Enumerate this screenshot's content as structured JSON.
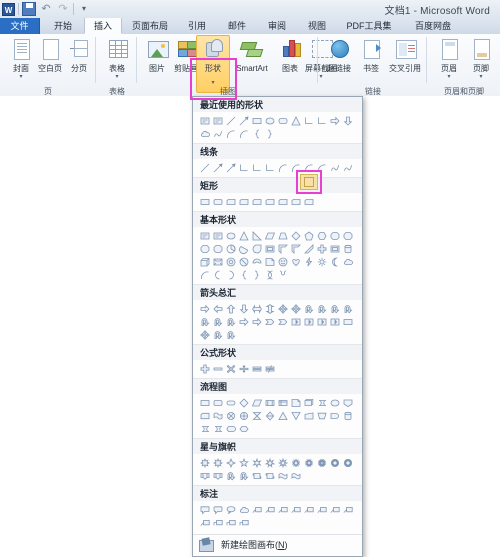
{
  "window": {
    "title": "文档1 - Microsoft Word",
    "quick_access": [
      {
        "name": "word-logo",
        "label": "W"
      },
      {
        "name": "save-icon",
        "label": ""
      },
      {
        "name": "undo-icon",
        "label": "↶"
      },
      {
        "name": "redo-icon",
        "label": "↷"
      },
      {
        "name": "customize-qat-icon",
        "label": "▾"
      }
    ]
  },
  "tabs": [
    {
      "label": "文件",
      "state": "file"
    },
    {
      "label": "开始",
      "state": "normal"
    },
    {
      "label": "插入",
      "state": "active"
    },
    {
      "label": "页面布局",
      "state": "normal"
    },
    {
      "label": "引用",
      "state": "normal"
    },
    {
      "label": "邮件",
      "state": "normal"
    },
    {
      "label": "审阅",
      "state": "normal"
    },
    {
      "label": "视图",
      "state": "normal"
    },
    {
      "label": "PDF工具集",
      "state": "normal"
    },
    {
      "label": "百度网盘",
      "state": "normal"
    }
  ],
  "ribbon": {
    "groups": [
      {
        "label": "页"
      },
      {
        "label": "表格"
      },
      {
        "label": "插图"
      },
      {
        "label": "链接"
      },
      {
        "label": "页眉和页脚"
      }
    ],
    "buttons": {
      "cover_page": "封面",
      "blank_page": "空白页",
      "page_break": "分页",
      "table": "表格",
      "picture": "图片",
      "clip_art": "剪贴画",
      "shapes": "形状",
      "smartart": "SmartArt",
      "chart": "图表",
      "screenshot": "屏幕截图",
      "hyperlink": "超链接",
      "bookmark": "书签",
      "cross_reference": "交叉引用",
      "header": "页眉",
      "footer": "页脚",
      "dropdown_arrow": "▾"
    }
  },
  "gallery": {
    "sections": [
      {
        "title": "最近使用的形状",
        "rows": [
          [
            "textbox",
            "textbox2",
            "line",
            "line-arrow",
            "rectangle",
            "oval",
            "rounded-rect",
            "triangle",
            "elbow-connector",
            "elbow-connector2",
            "right-arrow",
            "down-arrow"
          ],
          [
            "cloud-callout",
            "freeform-scribble",
            "arc",
            "curve",
            "left-brace",
            "right-brace"
          ]
        ]
      },
      {
        "title": "线条",
        "rows": [
          [
            "line",
            "line-arrow",
            "line-double-arrow",
            "elbow",
            "elbow-arrow",
            "elbow-double",
            "curve-connector",
            "curve-arrow",
            "curve-double",
            "arc",
            "freeform",
            "scribble"
          ]
        ]
      },
      {
        "title": "矩形",
        "rows": [
          [
            "rectangle",
            "rounded-rectangle",
            "snip-single-corner",
            "snip-same-side",
            "snip-diagonal",
            "snip-round-same-side",
            "round-single-corner",
            "round-same-side",
            "round-diagonal-corner"
          ]
        ]
      },
      {
        "title": "基本形状",
        "rows": [
          [
            "textbox",
            "textbox2",
            "oval",
            "triangle",
            "right-triangle",
            "parallelogram",
            "trapezoid",
            "diamond",
            "pentagon",
            "hexagon",
            "heptagon",
            "octagon"
          ],
          [
            "decagon",
            "dodecagon",
            "pie",
            "chord",
            "teardrop",
            "frame",
            "half-frame",
            "l-shape",
            "diagonal-stripe",
            "cross",
            "plaque",
            "can"
          ],
          [
            "cube",
            "bevel",
            "donut",
            "no-symbol",
            "block-arc",
            "folded-corner",
            "smiley-face",
            "heart",
            "lightning-bolt",
            "sun",
            "moon",
            "cloud"
          ],
          [
            "arc",
            "left-bracket",
            "right-bracket",
            "left-brace",
            "right-brace",
            "double-bracket",
            "double-brace"
          ]
        ]
      },
      {
        "title": "箭头总汇",
        "rows": [
          [
            "right-arrow",
            "left-arrow",
            "up-arrow",
            "down-arrow",
            "left-right-arrow",
            "up-down-arrow",
            "quad-arrow",
            "left-right-up-arrow",
            "bent-arrow",
            "u-turn-arrow",
            "bent-up-arrow",
            "curved-right"
          ],
          [
            "curved-left",
            "curved-up",
            "curved-down",
            "striped-right-arrow",
            "notched-right-arrow",
            "pentagon-arrow",
            "chevron",
            "right-arrow-callout",
            "down-arrow-callout",
            "left-arrow-callout",
            "up-arrow-callout",
            "left-right-callout"
          ],
          [
            "quad-arrow-callout",
            "circular-arrow",
            "swoosh-arrow"
          ]
        ]
      },
      {
        "title": "公式形状",
        "rows": [
          [
            "plus",
            "minus",
            "multiply",
            "divide",
            "equal",
            "not-equal"
          ]
        ]
      },
      {
        "title": "流程图",
        "rows": [
          [
            "process",
            "alternate-process",
            "terminator",
            "decision",
            "data",
            "predefined-process",
            "internal-storage",
            "document",
            "multidocument",
            "stored-data",
            "connector",
            "off-page-connector"
          ],
          [
            "card",
            "punched-tape",
            "summing-junction",
            "or",
            "collate",
            "sort",
            "extract",
            "merge",
            "manual-input",
            "manual-operation",
            "delay",
            "magnetic-disk"
          ],
          [
            "direct-access-storage",
            "sequential-access",
            "display",
            "preparation"
          ]
        ]
      },
      {
        "title": "星与旗帜",
        "rows": [
          [
            "explosion1",
            "explosion2",
            "star-4",
            "star-5",
            "star-6",
            "star-7",
            "star-8",
            "star-10",
            "star-12",
            "star-16",
            "star-24",
            "star-32"
          ],
          [
            "up-ribbon",
            "down-ribbon",
            "curved-up-ribbon",
            "curved-down-ribbon",
            "vertical-scroll",
            "horizontal-scroll",
            "wave",
            "double-wave"
          ]
        ]
      },
      {
        "title": "标注",
        "rows": [
          [
            "rect-callout",
            "rounded-callout",
            "oval-callout",
            "cloud-callout",
            "line-callout-1",
            "line-callout-2",
            "line-callout-3",
            "line-callout-1-ab",
            "line-callout-2-ab",
            "line-callout-3-ab",
            "line-callout-1-nb",
            "line-callout-2-nb"
          ],
          [
            "line-callout-3-nb",
            "callout-a",
            "callout-b",
            "callout-c"
          ]
        ]
      }
    ],
    "footer": {
      "label_before": "新建绘图画布(",
      "accel": "N",
      "label_after": ")",
      "icon": "new-drawing-canvas-icon"
    },
    "selected_shape": "rounded-rectangle"
  },
  "annotations": {
    "accent_color": "#e83fd0",
    "shapes_button_highlight": "#ffcf63"
  }
}
